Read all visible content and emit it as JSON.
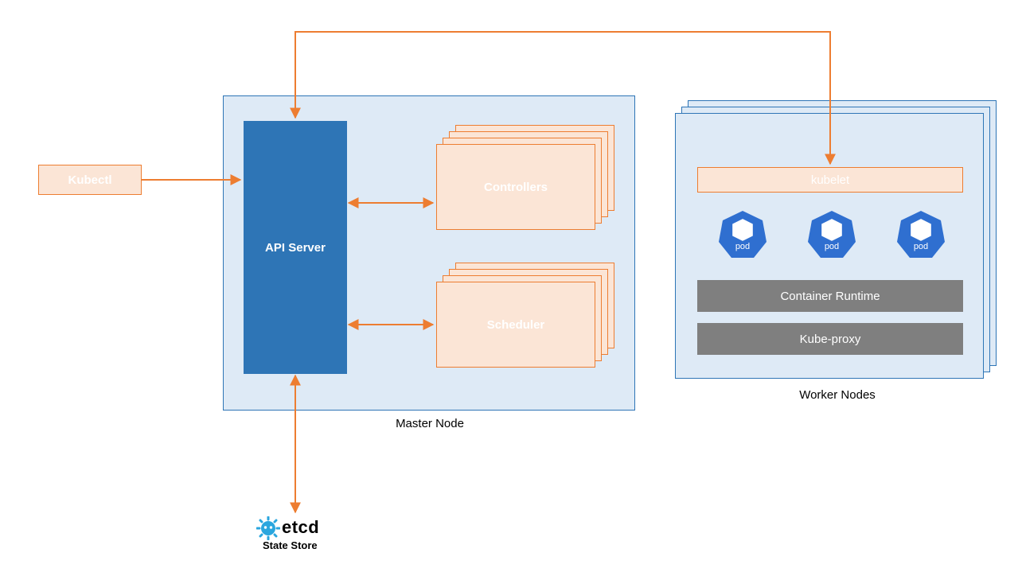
{
  "kubectl": {
    "label": "Kubectl"
  },
  "master": {
    "title": "Master Node",
    "api_server": "API Server",
    "controllers": "Controllers",
    "scheduler": "Scheduler"
  },
  "workers": {
    "title": "Worker Nodes",
    "kubelet": "kubelet",
    "pod_label": "pod",
    "container_runtime": "Container Runtime",
    "kube_proxy": "Kube-proxy"
  },
  "etcd": {
    "name": "etcd",
    "subtitle": "State Store"
  },
  "colors": {
    "orange": "#ed7d31",
    "blue_panel_border": "#2e75b6",
    "panel_fill": "#deeaf6",
    "api_fill": "#2e75b6",
    "peach_fill": "#fbe5d6",
    "gray_fill": "#7f7f7f",
    "pod_blue": "#2f6fd0",
    "etcd_icon": "#2aa6de"
  }
}
